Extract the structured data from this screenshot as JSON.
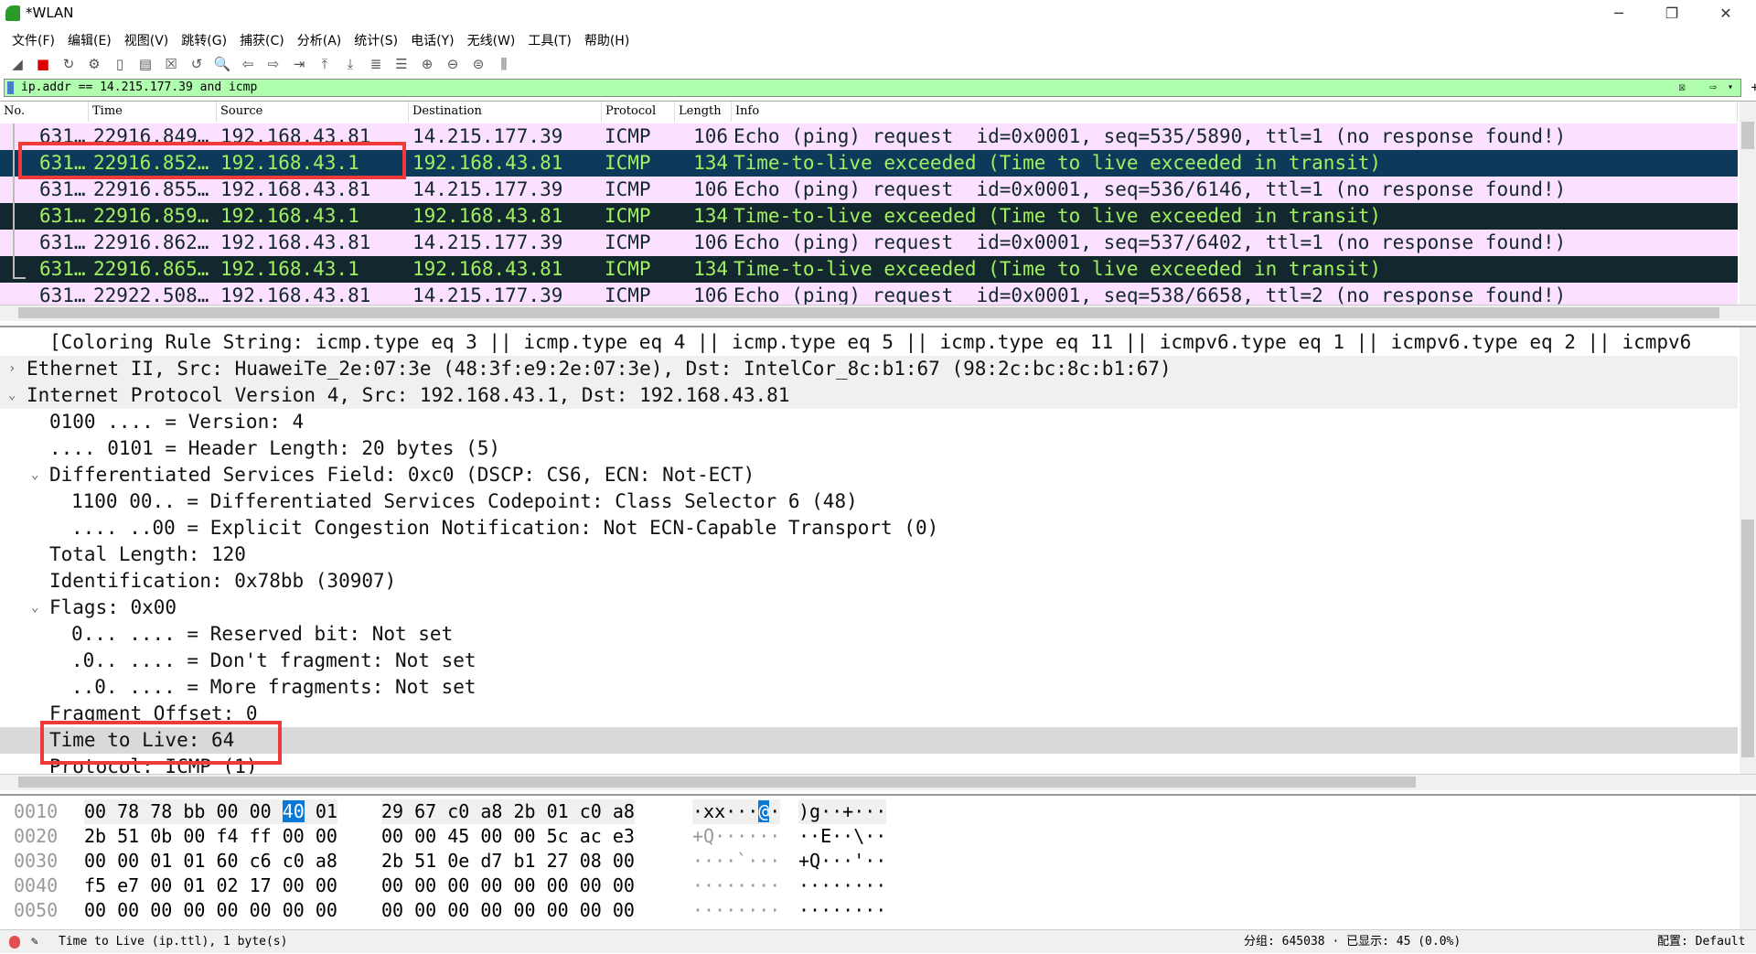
{
  "window": {
    "title": "*WLAN",
    "minimize": "─",
    "maximize": "❐",
    "close": "✕"
  },
  "menu": [
    "文件(F)",
    "编辑(E)",
    "视图(V)",
    "跳转(G)",
    "捕获(C)",
    "分析(A)",
    "统计(S)",
    "电话(Y)",
    "无线(W)",
    "工具(T)",
    "帮助(H)"
  ],
  "toolbar": [
    {
      "icon": "shark-fin-icon",
      "glyph": "◢"
    },
    {
      "icon": "stop-icon",
      "glyph": "■"
    },
    {
      "icon": "restart-icon",
      "glyph": "↻"
    },
    {
      "icon": "options-gear-icon",
      "glyph": "⚙"
    },
    {
      "icon": "open-icon",
      "glyph": "▯"
    },
    {
      "icon": "file-icon",
      "glyph": "▤"
    },
    {
      "icon": "close-file-icon",
      "glyph": "☒"
    },
    {
      "icon": "reload-icon",
      "glyph": "↺"
    },
    {
      "icon": "find-icon",
      "glyph": "🔍"
    },
    {
      "icon": "back-icon",
      "glyph": "⇦"
    },
    {
      "icon": "forward-icon",
      "glyph": "⇨"
    },
    {
      "icon": "go-to-packet-icon",
      "glyph": "⇥"
    },
    {
      "icon": "first-packet-icon",
      "glyph": "⤒"
    },
    {
      "icon": "last-packet-icon",
      "glyph": "⤓"
    },
    {
      "icon": "autoscroll-icon",
      "glyph": "≣"
    },
    {
      "icon": "colorize-icon",
      "glyph": "☰"
    },
    {
      "icon": "zoom-in-icon",
      "glyph": "⊕"
    },
    {
      "icon": "zoom-out-icon",
      "glyph": "⊖"
    },
    {
      "icon": "normal-size-icon",
      "glyph": "⊜"
    },
    {
      "icon": "resize-columns-icon",
      "glyph": "⫼"
    }
  ],
  "filter": {
    "value": "ip.addr == 14.215.177.39 and icmp"
  },
  "columns": [
    "No.",
    "Time",
    "Source",
    "Destination",
    "Protocol",
    "Length",
    "Info"
  ],
  "packets": [
    {
      "no": "631…",
      "time": "22916.849…",
      "src": "192.168.43.81",
      "dst": "14.215.177.39",
      "proto": "ICMP",
      "len": "106",
      "info": "Echo (ping) request  id=0x0001, seq=535/5890, ttl=1 (no response found!)",
      "kind": "req"
    },
    {
      "no": "631…",
      "time": "22916.852…",
      "src": "192.168.43.1",
      "dst": "192.168.43.81",
      "proto": "ICMP",
      "len": "134",
      "info": "Time-to-live exceeded (Time to live exceeded in transit)",
      "kind": "sel"
    },
    {
      "no": "631…",
      "time": "22916.855…",
      "src": "192.168.43.81",
      "dst": "14.215.177.39",
      "proto": "ICMP",
      "len": "106",
      "info": "Echo (ping) request  id=0x0001, seq=536/6146, ttl=1 (no response found!)",
      "kind": "req"
    },
    {
      "no": "631…",
      "time": "22916.859…",
      "src": "192.168.43.1",
      "dst": "192.168.43.81",
      "proto": "ICMP",
      "len": "134",
      "info": "Time-to-live exceeded (Time to live exceeded in transit)",
      "kind": "ttl"
    },
    {
      "no": "631…",
      "time": "22916.862…",
      "src": "192.168.43.81",
      "dst": "14.215.177.39",
      "proto": "ICMP",
      "len": "106",
      "info": "Echo (ping) request  id=0x0001, seq=537/6402, ttl=1 (no response found!)",
      "kind": "req"
    },
    {
      "no": "631…",
      "time": "22916.865…",
      "src": "192.168.43.1",
      "dst": "192.168.43.81",
      "proto": "ICMP",
      "len": "134",
      "info": "Time-to-live exceeded (Time to live exceeded in transit)",
      "kind": "ttl"
    },
    {
      "no": "631…",
      "time": "22922.508…",
      "src": "192.168.43.81",
      "dst": "14.215.177.39",
      "proto": "ICMP",
      "len": "106",
      "info": "Echo (ping) request  id=0x0001, seq=538/6658, ttl=2 (no response found!)",
      "kind": "req"
    }
  ],
  "details": [
    {
      "text": "[Coloring Rule String: icmp.type eq 3 || icmp.type eq 4 || icmp.type eq 5 || icmp.type eq 11 || icmpv6.type eq 1 || icmpv6.type eq 2 || icmpv6",
      "level": 1,
      "arrow": ""
    },
    {
      "text": "Ethernet II, Src: HuaweiTe_2e:07:3e (48:3f:e9:2e:07:3e), Dst: IntelCor_8c:b1:67 (98:2c:bc:8c:b1:67)",
      "level": 0,
      "arrow": "›",
      "bg": "g"
    },
    {
      "text": "Internet Protocol Version 4, Src: 192.168.43.1, Dst: 192.168.43.81",
      "level": 0,
      "arrow": "⌄",
      "bg": "g"
    },
    {
      "text": "0100 .... = Version: 4",
      "level": 1,
      "arrow": ""
    },
    {
      "text": ".... 0101 = Header Length: 20 bytes (5)",
      "level": 1,
      "arrow": ""
    },
    {
      "text": "Differentiated Services Field: 0xc0 (DSCP: CS6, ECN: Not-ECT)",
      "level": 1,
      "arrow": "⌄"
    },
    {
      "text": "1100 00.. = Differentiated Services Codepoint: Class Selector 6 (48)",
      "level": 2,
      "arrow": ""
    },
    {
      "text": ".... ..00 = Explicit Congestion Notification: Not ECN-Capable Transport (0)",
      "level": 2,
      "arrow": ""
    },
    {
      "text": "Total Length: 120",
      "level": 1,
      "arrow": ""
    },
    {
      "text": "Identification: 0x78bb (30907)",
      "level": 1,
      "arrow": ""
    },
    {
      "text": "Flags: 0x00",
      "level": 1,
      "arrow": "⌄"
    },
    {
      "text": "0... .... = Reserved bit: Not set",
      "level": 2,
      "arrow": ""
    },
    {
      "text": ".0.. .... = Don't fragment: Not set",
      "level": 2,
      "arrow": ""
    },
    {
      "text": "..0. .... = More fragments: Not set",
      "level": 2,
      "arrow": ""
    },
    {
      "text": "Fragment Offset: 0",
      "level": 1,
      "arrow": ""
    },
    {
      "text": "Time to Live: 64",
      "level": 1,
      "arrow": "",
      "bg": "hl"
    },
    {
      "text": "Protocol: ICMP (1)",
      "level": 1,
      "arrow": ""
    }
  ],
  "hex": [
    {
      "off": "0010",
      "b1": "00 78 78 bb 00 00 ",
      "sel": "40",
      "b1b": " 01",
      "b2": "29 67 c0 a8 2b 01 c0 a8",
      "a1": "·xx···",
      "asel": "@",
      "a1b": "·",
      "a2": ")g··+···"
    },
    {
      "off": "0020",
      "b1": "2b 51 0b 00 f4 ff 00 00",
      "b2": "00 00 45 00 00 5c ac e3",
      "a1": "+Q······",
      "a2": "··E··\\··"
    },
    {
      "off": "0030",
      "b1": "00 00 01 01 60 c6 c0 a8",
      "b2": "2b 51 0e d7 b1 27 08 00",
      "a1": "····`···",
      "a2": "+Q···'··"
    },
    {
      "off": "0040",
      "b1": "f5 e7 00 01 02 17 00 00",
      "b2": "00 00 00 00 00 00 00 00",
      "a1": "········",
      "a2": "········"
    },
    {
      "off": "0050",
      "b1": "00 00 00 00 00 00 00 00",
      "b2": "00 00 00 00 00 00 00 00",
      "a1": "········",
      "a2": "········"
    }
  ],
  "status": {
    "field": "Time to Live (ip.ttl), 1 byte(s)",
    "packets": "分组: 645038 · 已显示: 45 (0.0%)",
    "profile": "配置: Default"
  },
  "colors": {
    "request_bg": "#fce0ff",
    "ttl_bg": "#12272e",
    "selected_bg": "#0d3a5a",
    "ttl_fg": "#a0f060",
    "filter_bg": "#afffaf",
    "highlight_box": "#f03a3a"
  }
}
